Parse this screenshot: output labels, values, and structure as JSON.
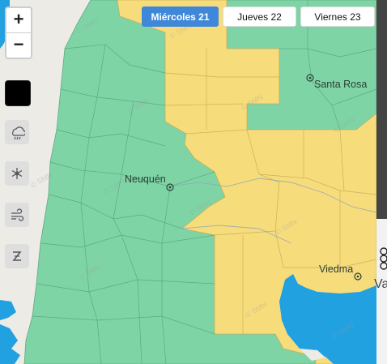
{
  "tabs": [
    {
      "label": "Miércoles 21",
      "active": true
    },
    {
      "label": "Jueves 22",
      "active": false
    },
    {
      "label": "Viernes 23",
      "active": false
    }
  ],
  "zoom": {
    "in": "+",
    "out": "−"
  },
  "layers": [
    {
      "name": "color-swatch"
    },
    {
      "name": "rain-icon"
    },
    {
      "name": "snow-icon"
    },
    {
      "name": "wind-icon"
    },
    {
      "name": "zonda-icon"
    }
  ],
  "cities": {
    "santa_rosa": "Santa Rosa",
    "neuquen": "Neuquén",
    "viedma": "Viedma"
  },
  "colors": {
    "green_alert": "#7fd4a6",
    "yellow_alert": "#f7dc7b",
    "sea": "#22a1e0",
    "land": "#ecebe6",
    "active_tab": "#3f88d9"
  },
  "watermark": "SMN",
  "edge_text": "Va"
}
